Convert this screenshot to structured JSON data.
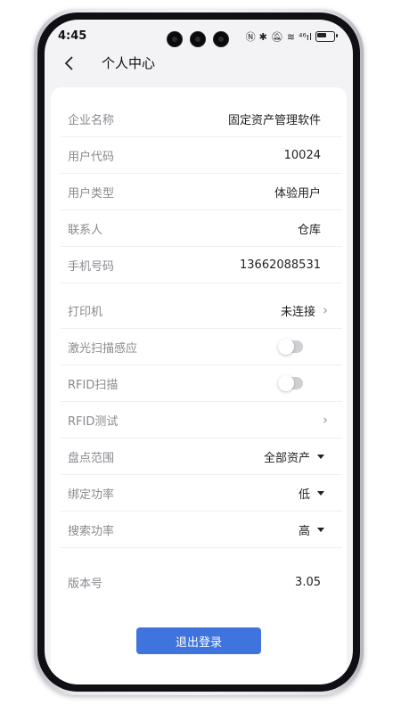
{
  "status_bar": {
    "time": "4:45",
    "battery_label": "battery",
    "signal_text": "⁴⁶ıl"
  },
  "header": {
    "title": "个人中心"
  },
  "info_rows": [
    {
      "label": "企业名称",
      "value": "固定资产管理软件"
    },
    {
      "label": "用户代码",
      "value": "10024"
    },
    {
      "label": "用户类型",
      "value": "体验用户"
    },
    {
      "label": "联系人",
      "value": "仓库"
    },
    {
      "label": "手机号码",
      "value": "13662088531"
    }
  ],
  "settings": {
    "printer": {
      "label": "打印机",
      "value": "未连接"
    },
    "laser_scan": {
      "label": "激光扫描感应",
      "enabled": false
    },
    "rfid_scan": {
      "label": "RFID扫描",
      "enabled": false
    },
    "rfid_test": {
      "label": "RFID测试"
    },
    "inventory_range": {
      "label": "盘点范围",
      "value": "全部资产"
    },
    "bind_power": {
      "label": "绑定功率",
      "value": "低"
    },
    "search_power": {
      "label": "搜索功率",
      "value": "高"
    }
  },
  "version": {
    "label": "版本号",
    "value": "3.05"
  },
  "logout_label": "退出登录",
  "colors": {
    "accent": "#3f73de",
    "background": "#f3f3f6",
    "card": "#ffffff"
  }
}
